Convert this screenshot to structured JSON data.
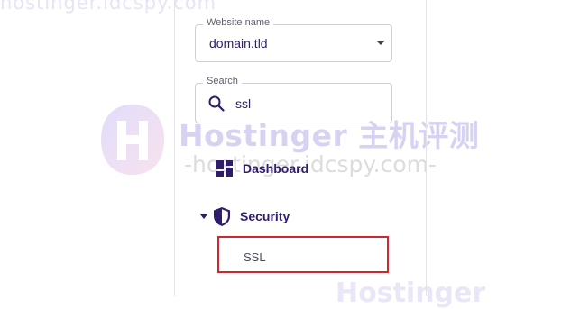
{
  "watermarks": {
    "top_text": "hostinger.idcspy.com",
    "brand_text": "Hostinger 主机评测",
    "url_text": "-hostinger.idcspy.com-",
    "bottom_text": "Hostinger"
  },
  "website_select": {
    "label": "Website name",
    "value": "domain.tld"
  },
  "search": {
    "label": "Search",
    "value": "ssl"
  },
  "nav": {
    "dashboard_label": "Dashboard",
    "security_label": "Security",
    "ssl_label": "SSL"
  },
  "colors": {
    "accent": "#2f1c6a",
    "highlight_border": "#d0262d",
    "field_border": "#cfcfd6"
  },
  "icons": {
    "dashboard": "dashboard-grid-icon",
    "security": "shield-icon",
    "search": "search-icon",
    "select_caret": "chevron-down-icon",
    "expand": "expand-arrow-icon"
  }
}
